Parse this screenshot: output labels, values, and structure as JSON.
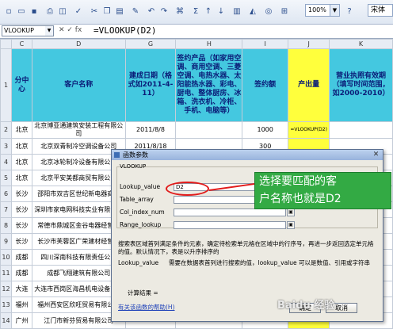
{
  "toolbar": {
    "zoom": "100%",
    "font": "宋体"
  },
  "formula_bar": {
    "name_box": "VLOOKUP",
    "formula": "=VLOOKUP(D2)"
  },
  "columns": [
    "C",
    "D",
    "G",
    "H",
    "I",
    "J",
    "K"
  ],
  "header_row": {
    "row_num": "1",
    "c": "分中心",
    "d": "客户名称",
    "g": "建成日期（格式如2011-4-11）",
    "h": "签约产品（如家用空调、商用空调、三菱空调、电热水器、太阳能热水器、彩电、厨电、整体厨房、冰箱、洗衣机、冷柜、手机、电脑等）",
    "i": "签约额",
    "j": "产出量",
    "k": "营业执照有效期（填写时间范围，如2000-2010）"
  },
  "rows": [
    {
      "num": "2",
      "c": "北京",
      "d": "北京博亚通建筑安装工程有限公司",
      "g": "2011/8/8",
      "i": "1000",
      "j": "=VLOOKUP(D2)"
    },
    {
      "num": "3",
      "c": "北京",
      "d": "北京双青制冷空调设备公司",
      "g": "2011/8/18",
      "i": "300",
      "j": ""
    },
    {
      "num": "4",
      "c": "北京",
      "d": "北京冰轮制冷设备有限公司",
      "g": "",
      "i": "",
      "j": ""
    },
    {
      "num": "5",
      "c": "北京",
      "d": "北京平安美都商贸有限公司",
      "g": "",
      "i": "",
      "j": ""
    },
    {
      "num": "6",
      "c": "长沙",
      "d": "邵阳市双吉区世纪新电器商行",
      "g": "",
      "i": "",
      "j": ""
    },
    {
      "num": "7",
      "c": "长沙",
      "d": "深圳市家电网科技实业有限公司",
      "g": "",
      "i": "",
      "j": ""
    },
    {
      "num": "8",
      "c": "长沙",
      "d": "常德市鼎城区金谷电器经营部",
      "g": "",
      "i": "",
      "j": ""
    },
    {
      "num": "9",
      "c": "长沙",
      "d": "长沙市芙蓉区广荣建材经营部",
      "g": "",
      "i": "",
      "j": ""
    },
    {
      "num": "10",
      "c": "成都",
      "d": "四川深南科技有限责任公司",
      "g": "",
      "i": "",
      "j": ""
    },
    {
      "num": "11",
      "c": "成都",
      "d": "成都飞翔建筑有限公司",
      "g": "",
      "i": "",
      "j": ""
    },
    {
      "num": "12",
      "c": "大连",
      "d": "大连市西岗区海昌机电设备商行",
      "g": "",
      "i": "",
      "j": ""
    },
    {
      "num": "13",
      "c": "福州",
      "d": "福州西安区欣旺贸易有限公司",
      "g": "",
      "i": "",
      "j": ""
    },
    {
      "num": "14",
      "c": "广州",
      "d": "江门市新芬贸易有限公司",
      "g": "",
      "i": "",
      "j": ""
    }
  ],
  "dialog": {
    "title": "函数参数",
    "function_name": "VLOOKUP",
    "args": [
      {
        "label": "Lookup_value",
        "value": "D2",
        "result": ""
      },
      {
        "label": "Table_array",
        "value": "",
        "result": ""
      },
      {
        "label": "Col_index_num",
        "value": "",
        "result": ""
      },
      {
        "label": "Range_lookup",
        "value": "",
        "result": ""
      }
    ],
    "description": "搜索表区域首列满足条件的元素，确定待检索单元格在区域中的行序号，再进一步返回选定单元格的值。默认情况下，表是以升序排序的",
    "arg_desc_label": "Lookup_value",
    "arg_desc": "需要在数据表首列进行搜索的值，lookup_value 可以是数值、引用或字符串",
    "result_label": "计算结果 =",
    "help_link": "有关该函数的帮助(H)",
    "ok": "确定",
    "cancel": "取消"
  },
  "callout": {
    "line1": "选择要匹配的客",
    "line2": "户名称也就是D2"
  },
  "watermark": "Baidu 经验"
}
